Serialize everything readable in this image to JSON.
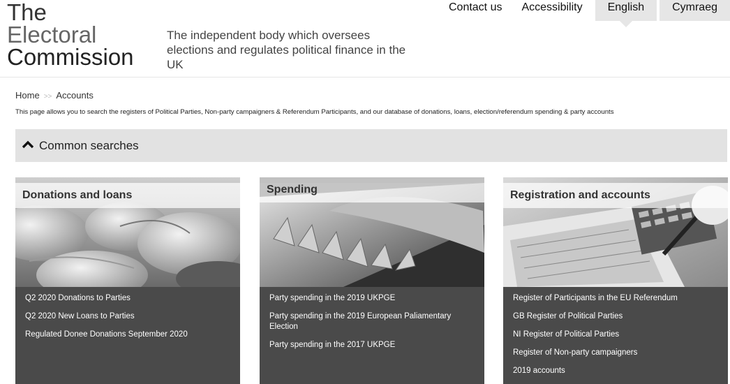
{
  "logo": {
    "line1": "The",
    "line2": "Electoral",
    "line3": "Commission"
  },
  "tagline": "The independent body which oversees elections and regulates political finance in the UK",
  "topnav": {
    "contact": "Contact us",
    "accessibility": "Accessibility",
    "english": "English",
    "cymraeg": "Cymraeg"
  },
  "breadcrumb": {
    "home": "Home",
    "separator": ">>",
    "current": "Accounts"
  },
  "intro": "This page allows you to search the registers of Political Parties, Non-party campaigners & Referendum Participants, and our database of donations, loans, election/referendum spending & party accounts",
  "common_searches": {
    "label": "Common searches"
  },
  "cards": [
    {
      "title": "Donations and loans",
      "links": [
        "Q2 2020 Donations to Parties",
        "Q2 2020 New Loans to Parties",
        "Regulated Donee Donations September 2020"
      ]
    },
    {
      "title": "Spending",
      "links": [
        "Party spending in the 2019 UKPGE",
        "Party spending in the 2019 European Paliamentary Election",
        "Party spending in the 2017 UKPGE"
      ]
    },
    {
      "title": "Registration and accounts",
      "links": [
        "Register of Participants in the EU Referendum",
        "GB Register of Political Parties",
        "NI Register of Political Parties",
        "Register of Non-party campaigners",
        "2019 accounts"
      ]
    }
  ],
  "colors": {
    "card_bg": "#4a4a4a",
    "bar_bg": "#e2e2e2",
    "lang_bg": "#e6e6e6"
  }
}
